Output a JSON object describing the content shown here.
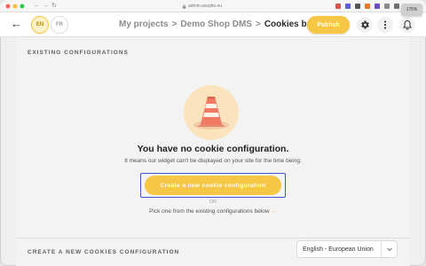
{
  "browser": {
    "url": "admin.axeptio.eu",
    "zoom": "175%",
    "extension_colors": [
      "#d9534f",
      "#5a5fd6",
      "#555555",
      "#e9782d",
      "#6b4bc3",
      "#8a8a8a",
      "#6e6e6e"
    ]
  },
  "header": {
    "languages": [
      "EN",
      "FR"
    ],
    "active_language": "EN",
    "breadcrumb": [
      "My projects",
      "Demo Shop DMS",
      "Cookies banner"
    ],
    "publish_label": "Publish"
  },
  "main": {
    "existing_title": "EXISTING CONFIGURATIONS",
    "empty_title": "You have no cookie configuration.",
    "empty_subtitle": "It means our widget can't be displayed on your site for the time being.",
    "create_label": "Create a new cookie configuration",
    "or_label": "OR",
    "pick_label": "Pick one from the existing configurations below",
    "pick_arrow": "→",
    "create_section_title": "CREATE A NEW COOKIES CONFIGURATION",
    "region_selected": "English - European Union"
  },
  "colors": {
    "accent": "#f6c744",
    "focus": "#3a56c8"
  }
}
